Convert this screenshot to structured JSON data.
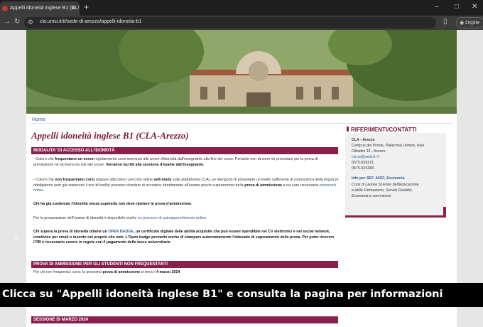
{
  "browser": {
    "tab_title": "Appelli idoneità inglese B1 (CL/",
    "url": "cla.unisi.it/it/sede-di-arezzo/appelli-idoneita-b1",
    "profile_label": "Ospite"
  },
  "page": {
    "breadcrumb": "Home",
    "title": "Appelli idoneità inglese B1 (CLA-Arezzo)",
    "section1_heading": "MODALITA' DI ACCESSO ALL'IDONEITÀ",
    "p1_pre": "- Coloro che ",
    "p1_b1": "frequentano un corso",
    "p1_mid": " regolarmente sono ammessi alle prove d'idoneità dall'insegnante alla fine del corso. Pertanto non devono né prenotarsi per la prova di ammissione né iscriversi da soli alle prove. ",
    "p1_b2": "Verranno iscritti alla sessione d'esame dall'insegnante.",
    "p2_pre": "- Coloro che ",
    "p2_b1": "non frequentano corsi",
    "p2_mid": " (oppure utilizzano i percorsi online ",
    "p2_b2": "self-study",
    "p2_mid2": " sulla piattaforma CLA), se ritengono di possedere un livello sufficiente di conoscenza della lingua (è obbligatorio aver già sostenuto il test di livello) possono chiedere di accedere direttamente all'esame previo superamento della ",
    "p2_b3": "prova di ammissione",
    "p2_end": " a cui sarà necessario ",
    "p2_link": "prenotarsi online",
    "p2_dot": ".",
    "p3": "Chi ha già sostenuto l'idoneità senza superarla non deve ripetere la prova d'ammissione.",
    "p4_pre": "Per la preparazione dell'esame di idoneità è disponibile anche ",
    "p4_link": "un percorso di autoapprendimento online",
    "p4_end": ".",
    "p5_pre": "Chi supera la prova di idoneità ottiene un ",
    "p5_link": "OPEN BADGE",
    "p5_rest": ", un certificato digitale delle abilità acquisite che può essere spendibile nei CV elettronici e nei social network, condiviso per email o inserito nel proprio sito web. L'Open badge permette anche di stampare autonomamente l'attestato di superamento della prova. Per poter ricevere l'OB è necessario essere in regola con il pagamento delle tasse universitarie.",
    "section2_heading": "PROVA DI AMMISSIONE PER GLI STUDENTI NON FREQUENTANTI",
    "p6_pre": "Per chi non frequenta i corsi, la prossima ",
    "p6_b1": "prova di ammissione",
    "p6_mid": " si terrà il ",
    "p6_b2": "4 marzo 2024",
    "section3_heading": "SESSIONE DI MARZO 2024"
  },
  "sidebar": {
    "heading": "RIFERIMENTI/CONTATTI",
    "name": "CLA - Arezzo",
    "addr1": "Campus del Pionta, Palazzina Uomini, viale",
    "addr2": "Cittadini 33 - Arezzo",
    "email": "cla-ar@unisi.it",
    "phone1": "0575-926221",
    "phone2": "0575-926384",
    "info_title": "Info per SEF, ANCI, Economia",
    "info1": "Corsi di Laurea Scienze dell'Educazione",
    "info2": "e della Formazione, Servizi Giuridici,",
    "info3": "Economia e commercio"
  },
  "caption": "Clicca su \"Appelli idoneità inglese B1\" e consulta la pagina per informazioni",
  "colors": {
    "accent": "#8a1f4b",
    "title": "#7a1940",
    "link": "#2f5d93"
  }
}
